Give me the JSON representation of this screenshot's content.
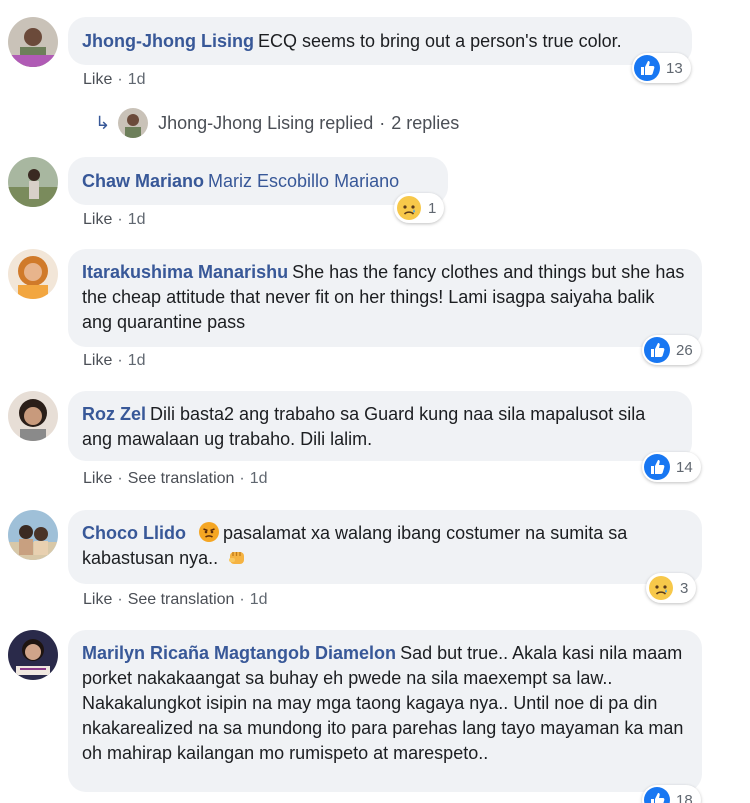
{
  "comments": [
    {
      "author": "Jhong-Jhong Lising",
      "text": "ECQ seems to bring out a person's true color.",
      "like": "Like",
      "time": "1d",
      "reaction": {
        "icon": "like-icon",
        "count": "13"
      },
      "replies": {
        "author": "Jhong-Jhong Lising replied",
        "count": "2 replies"
      }
    },
    {
      "author": "Chaw Mariano",
      "tag": "Mariz Escobillo Mariano",
      "like": "Like",
      "time": "1d",
      "reaction": {
        "icon": "sad-icon",
        "count": "1"
      }
    },
    {
      "author": "Itarakushima Manarishu",
      "text": "She has the fancy clothes and things but she has the cheap attitude that never fit on her things! Lami isagpa saiyaha balik ang quarantine pass",
      "like": "Like",
      "time": "1d",
      "reaction": {
        "icon": "like-icon",
        "count": "26"
      }
    },
    {
      "author": "Roz Zel",
      "text": "Dili basta2 ang trabaho sa Guard kung naa sila mapalusot sila ang mawalaan ug trabaho. Dili lalim.",
      "like": "Like",
      "see_translation": "See translation",
      "time": "1d",
      "reaction": {
        "icon": "like-icon",
        "count": "14"
      }
    },
    {
      "author": "Choco Llido",
      "text": "pasalamat xa walang ibang costumer na sumita sa kabastusan nya..",
      "like": "Like",
      "see_translation": "See translation",
      "time": "1d",
      "reaction": {
        "icon": "sad-icon",
        "count": "3"
      }
    },
    {
      "author": "Marilyn Ricaña Magtangob Diamelon",
      "text": "Sad but true.. Akala kasi nila maam porket nakakaangat sa buhay eh pwede na sila maexempt sa law.. Nakakalungkot isipin na may mga taong kagaya nya.. Until noe di pa din nkakarealized na sa mundong ito para parehas lang tayo mayaman ka man oh mahirap kailangan mo rumispeto at marespeto..",
      "reaction": {
        "icon": "like-icon",
        "count": "18"
      }
    }
  ],
  "colors": {
    "link": "#385898",
    "bubble": "#f0f2f5",
    "like_blue": "#1877f2",
    "meta": "#606770"
  }
}
